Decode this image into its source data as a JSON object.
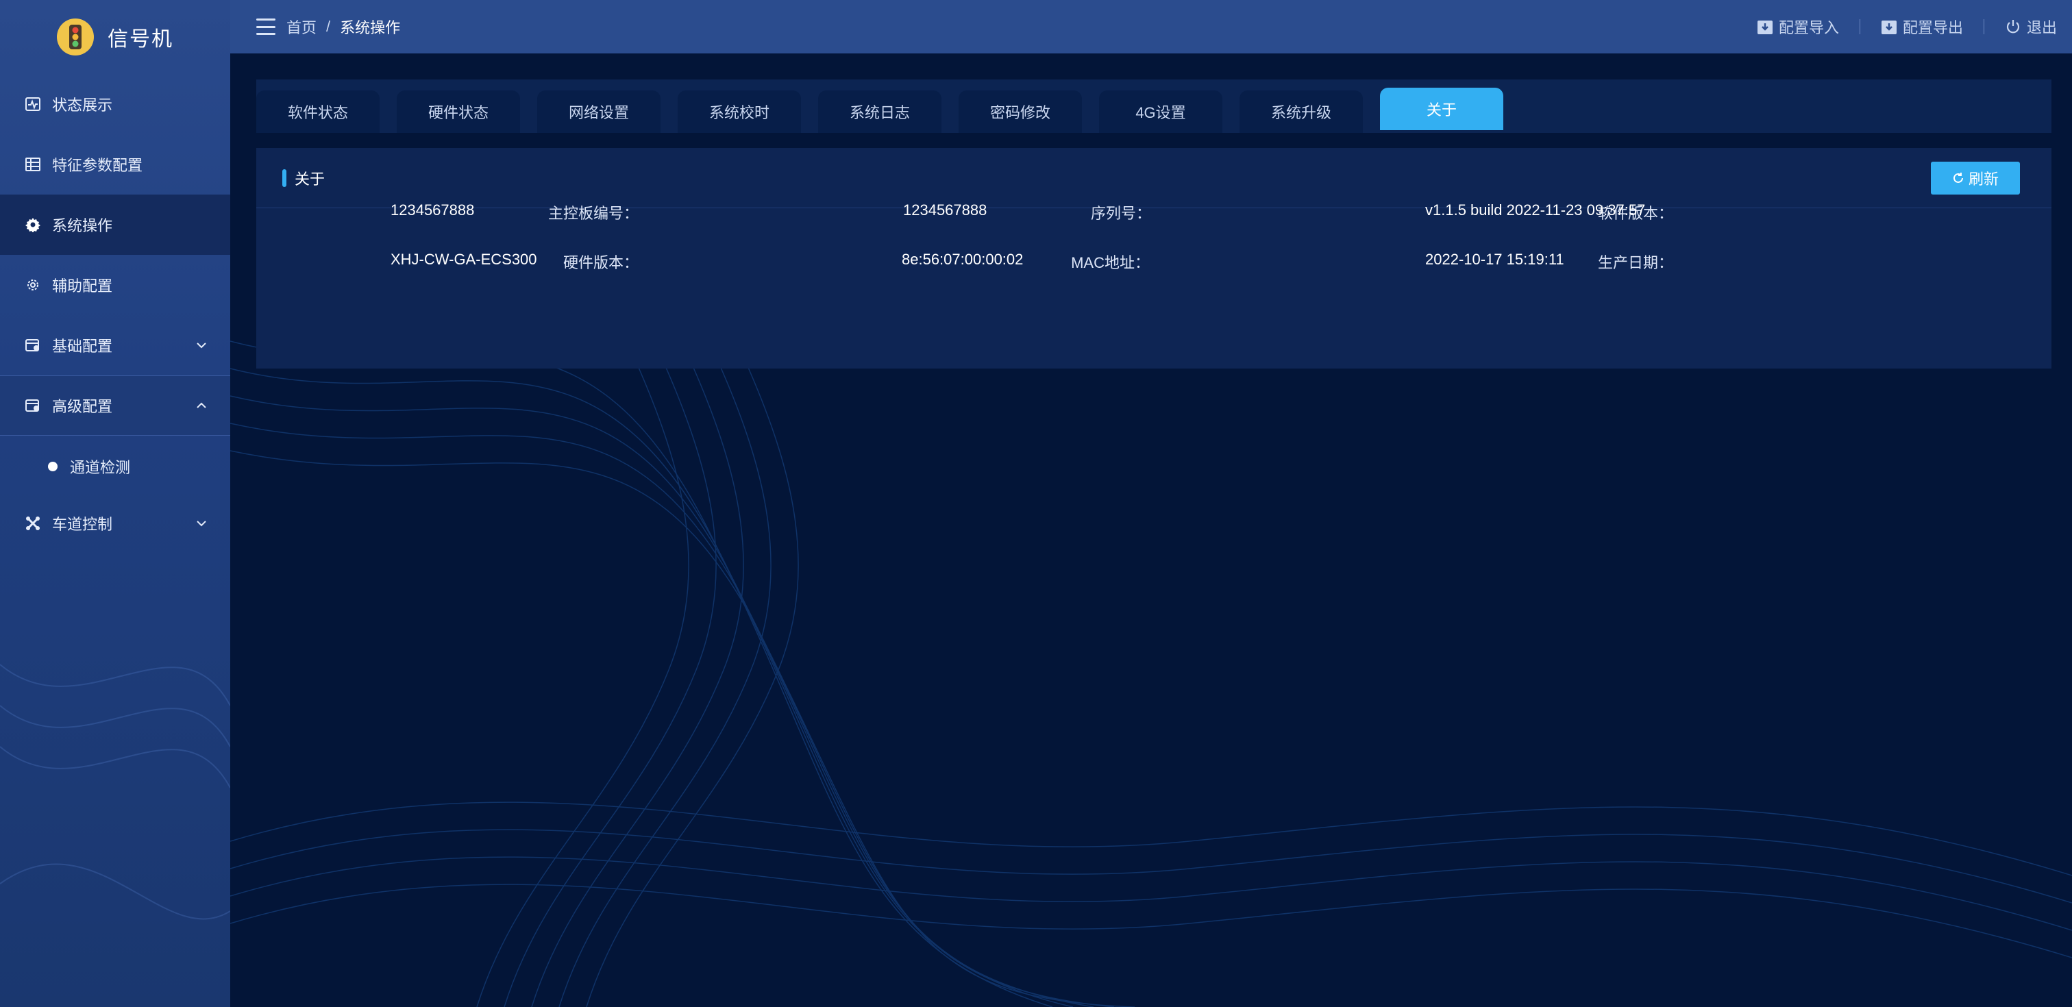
{
  "brand": {
    "title": "信号机",
    "logo_icon": "traffic-light-icon"
  },
  "sidebar": {
    "items": [
      {
        "label": "状态展示",
        "icon": "pulse-chart-icon"
      },
      {
        "label": "特征参数配置",
        "icon": "table-grid-icon"
      },
      {
        "label": "系统操作",
        "icon": "gear-icon"
      },
      {
        "label": "辅助配置",
        "icon": "cog-outline-icon"
      },
      {
        "label": "基础配置",
        "icon": "config-card-icon"
      },
      {
        "label": "高级配置",
        "icon": "config-card-icon"
      },
      {
        "label": "车道控制",
        "icon": "lane-cross-icon"
      }
    ],
    "subitems": [
      {
        "label": "通道检测"
      }
    ]
  },
  "header": {
    "breadcrumb": [
      "首页",
      "系统操作"
    ],
    "separator": "/",
    "actions": {
      "import_label": "配置导入",
      "export_label": "配置导出",
      "logout_label": "退出"
    }
  },
  "tabs": [
    "软件状态",
    "硬件状态",
    "网络设置",
    "系统校时",
    "系统日志",
    "密码修改",
    "4G设置",
    "系统升级",
    "关于"
  ],
  "about": {
    "title": "关于",
    "refresh_label": "刷新",
    "fields": {
      "board_no": {
        "label": "主控板编号：",
        "value": "1234567888"
      },
      "serial_no": {
        "label": "序列号：",
        "value": "1234567888"
      },
      "software_version": {
        "label": "软件版本：",
        "value": "v1.1.5 build 2022-11-23 09:37:57"
      },
      "hardware_version": {
        "label": "硬件版本：",
        "value": "XHJ-CW-GA-ECS300"
      },
      "mac_address": {
        "label": "MAC地址：",
        "value": "8e:56:07:00:00:02"
      },
      "production_date": {
        "label": "生产日期：",
        "value": "2022-10-17 15:19:11"
      }
    }
  },
  "colors": {
    "accent": "#33aff2",
    "sidebar_bg": "#2a4a8c",
    "header_bg": "#2b4c8e",
    "main_bg": "#031538",
    "panel_bg": "#0e2554"
  }
}
